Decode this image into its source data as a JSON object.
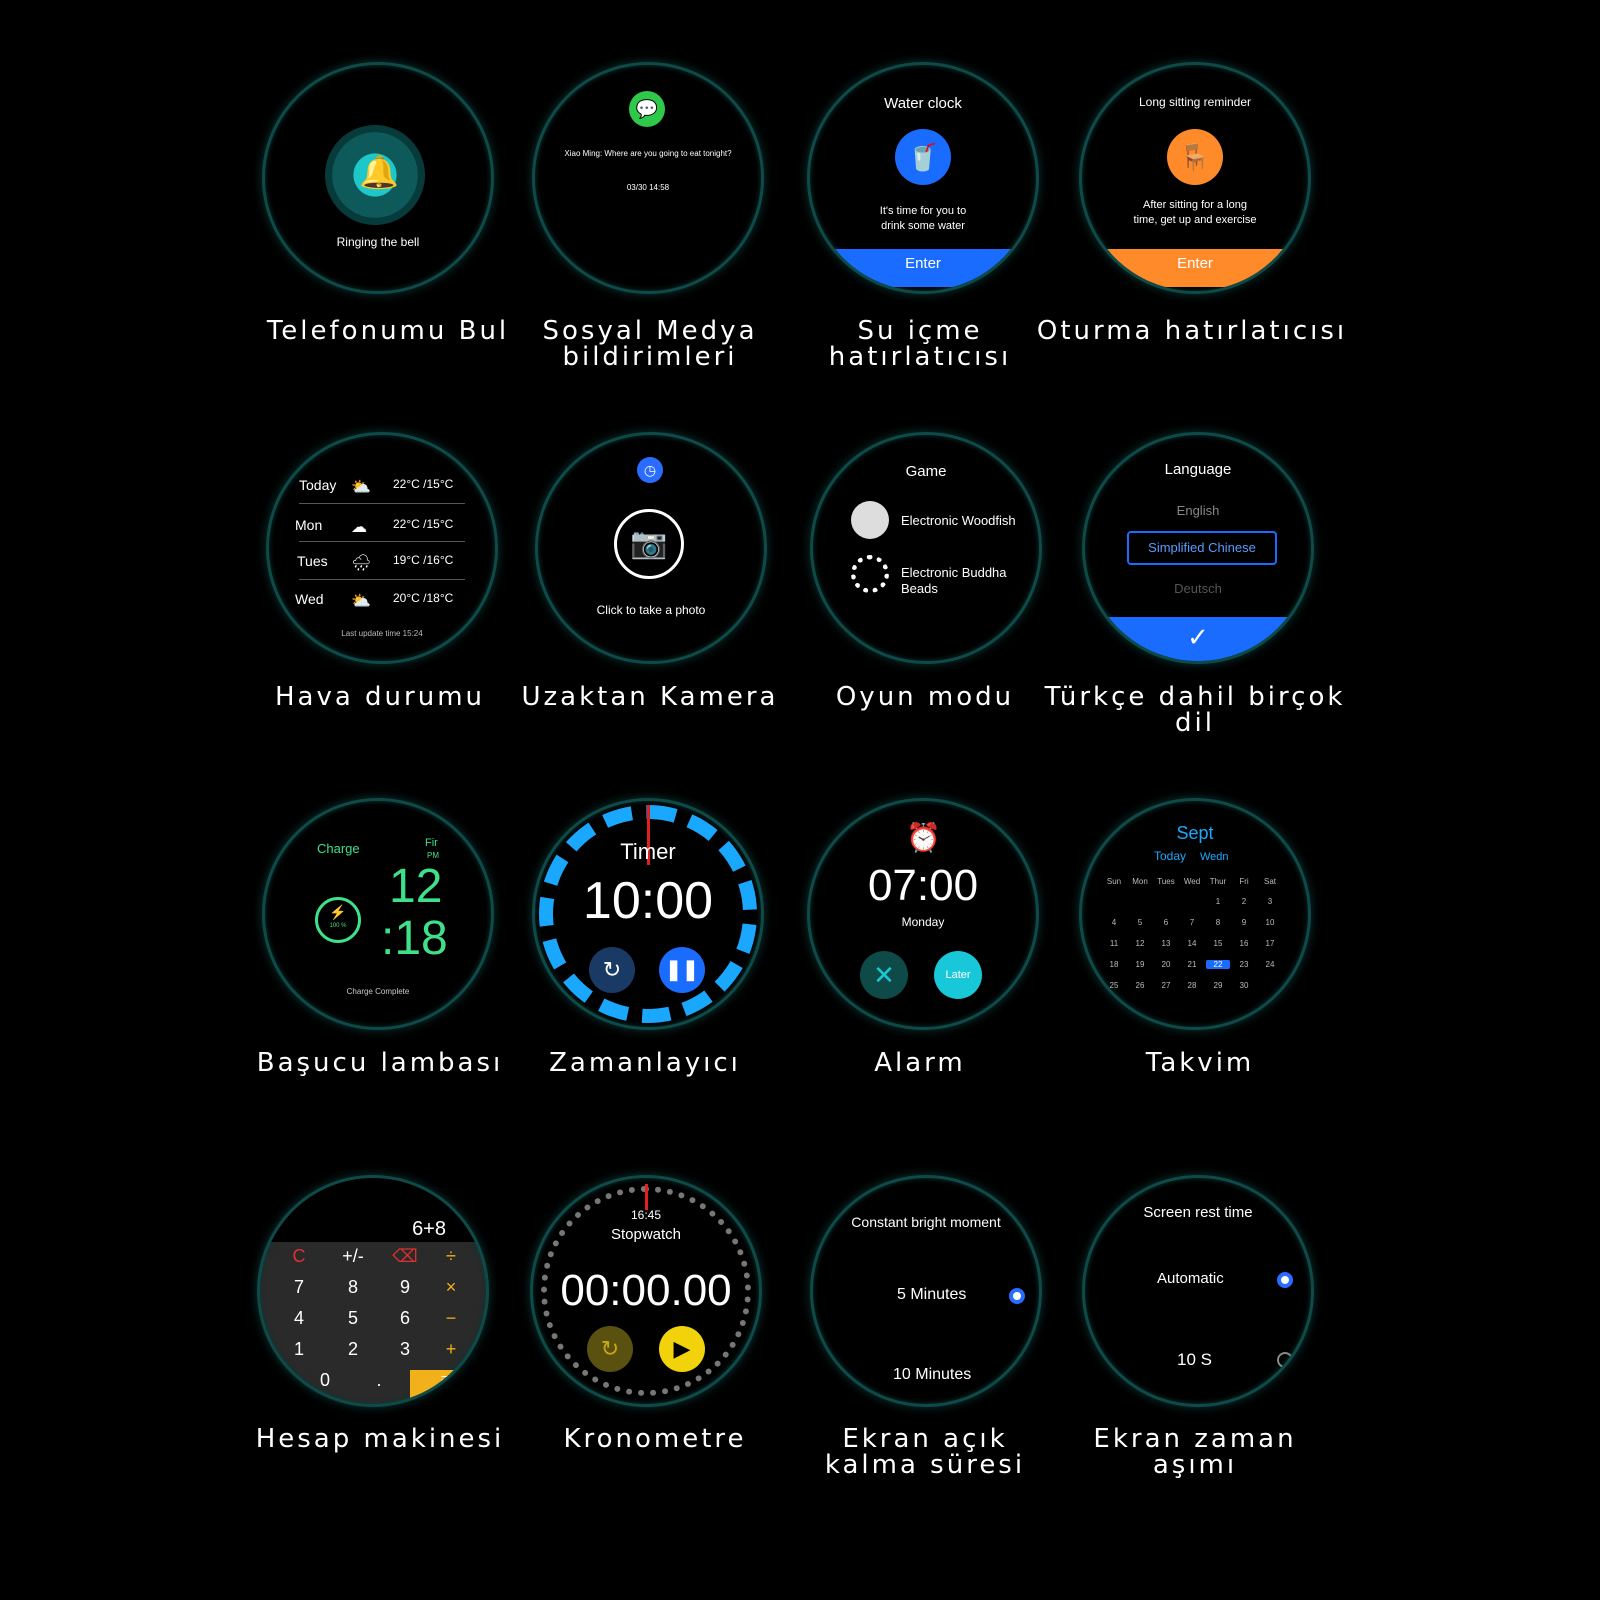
{
  "features": [
    {
      "label": "Telefonumu Bul",
      "screen": {
        "text": "Ringing the bell",
        "icon": "bell-icon"
      }
    },
    {
      "label": "Sosyal Medya bildirimleri",
      "screen": {
        "icon": "wechat-icon",
        "message": "Xiao Ming: Where are you going to eat tonight?",
        "time": "03/30 14:58"
      }
    },
    {
      "label": "Su içme hatırlatıcısı",
      "screen": {
        "title": "Water clock",
        "icon": "water-cup-icon",
        "text1": "It's time for you to",
        "text2": "drink some water",
        "button": "Enter",
        "accent": "#1a6cff"
      }
    },
    {
      "label": "Oturma hatırlatıcısı",
      "screen": {
        "title": "Long sitting reminder",
        "icon": "sitting-person-icon",
        "text1": "After sitting for a long",
        "text2": "time, get up and exercise",
        "button": "Enter",
        "accent": "#ff8a2a"
      }
    },
    {
      "label": "Hava durumu",
      "screen": {
        "rows": [
          {
            "day": "Today",
            "temp": "22°C /15°C",
            "icon": "partly-sunny-icon"
          },
          {
            "day": "Mon",
            "temp": "22°C /15°C",
            "icon": "cloud-icon"
          },
          {
            "day": "Tues",
            "temp": "19°C /16°C",
            "icon": "rain-icon"
          },
          {
            "day": "Wed",
            "temp": "20°C /18°C",
            "icon": "partly-sunny-icon"
          }
        ],
        "footer": "Last update time 15:24"
      }
    },
    {
      "label": "Uzaktan Kamera",
      "screen": {
        "icon": "camera-icon",
        "text": "Click to take a photo"
      }
    },
    {
      "label": "Oyun modu",
      "screen": {
        "title": "Game",
        "item1": "Electronic Woodfish",
        "item2a": "Electronic Buddha",
        "item2b": "Beads"
      }
    },
    {
      "label": "Türkçe dahil birçok dil",
      "screen": {
        "title": "Language",
        "opt1": "English",
        "selected": "Simplified Chinese",
        "opt3": "Deutsch",
        "accent": "#1a6cff"
      }
    },
    {
      "label": "Başucu lambası",
      "screen": {
        "title": "Charge",
        "day": "Fir",
        "ampm": "PM",
        "hour": "12",
        "minute": ":18",
        "percent": "100 %",
        "footer": "Charge Complete",
        "accent": "#3ee08a"
      }
    },
    {
      "label": "Zamanlayıcı",
      "screen": {
        "title": "Timer",
        "time": "10:00",
        "accent": "#1aa8ff"
      }
    },
    {
      "label": "Alarm",
      "screen": {
        "time": "07:00",
        "day": "Monday",
        "later": "Later",
        "accent": "#18c8d8"
      }
    },
    {
      "label": "Takvim",
      "screen": {
        "month": "Sept",
        "today": "Today",
        "weekday": "Wedn",
        "headers": [
          "Sun",
          "Mon",
          "Tues",
          "Wed",
          "Thur",
          "Fri",
          "Sat"
        ],
        "weeks": [
          [
            "",
            "",
            "",
            "",
            "1",
            "2",
            "3"
          ],
          [
            "4",
            "5",
            "6",
            "7",
            "8",
            "9",
            "10"
          ],
          [
            "11",
            "12",
            "13",
            "14",
            "15",
            "16",
            "17"
          ],
          [
            "18",
            "19",
            "20",
            "21",
            "22",
            "23",
            "24"
          ],
          [
            "25",
            "26",
            "27",
            "28",
            "29",
            "30",
            ""
          ]
        ],
        "highlight": "22"
      }
    },
    {
      "label": "Hesap makinesi",
      "screen": {
        "display": "6+8",
        "keys": [
          [
            "C",
            "+/-",
            "⌫",
            "÷"
          ],
          [
            "7",
            "8",
            "9",
            "×"
          ],
          [
            "4",
            "5",
            "6",
            "−"
          ],
          [
            "1",
            "2",
            "3",
            "+"
          ],
          [
            "0",
            ".",
            "="
          ]
        ]
      }
    },
    {
      "label": "Kronometre",
      "screen": {
        "clock": "16:45",
        "title": "Stopwatch",
        "time": "00:00.00",
        "accent": "#f2d20a"
      }
    },
    {
      "label": "Ekran açık kalma süresi",
      "screen": {
        "title": "Constant bright moment",
        "opt1": "5 Minutes",
        "opt2": "10 Minutes"
      }
    },
    {
      "label": "Ekran zaman aşımı",
      "screen": {
        "title": "Screen rest time",
        "opt1": "Automatic",
        "opt2": "10 S"
      }
    }
  ]
}
